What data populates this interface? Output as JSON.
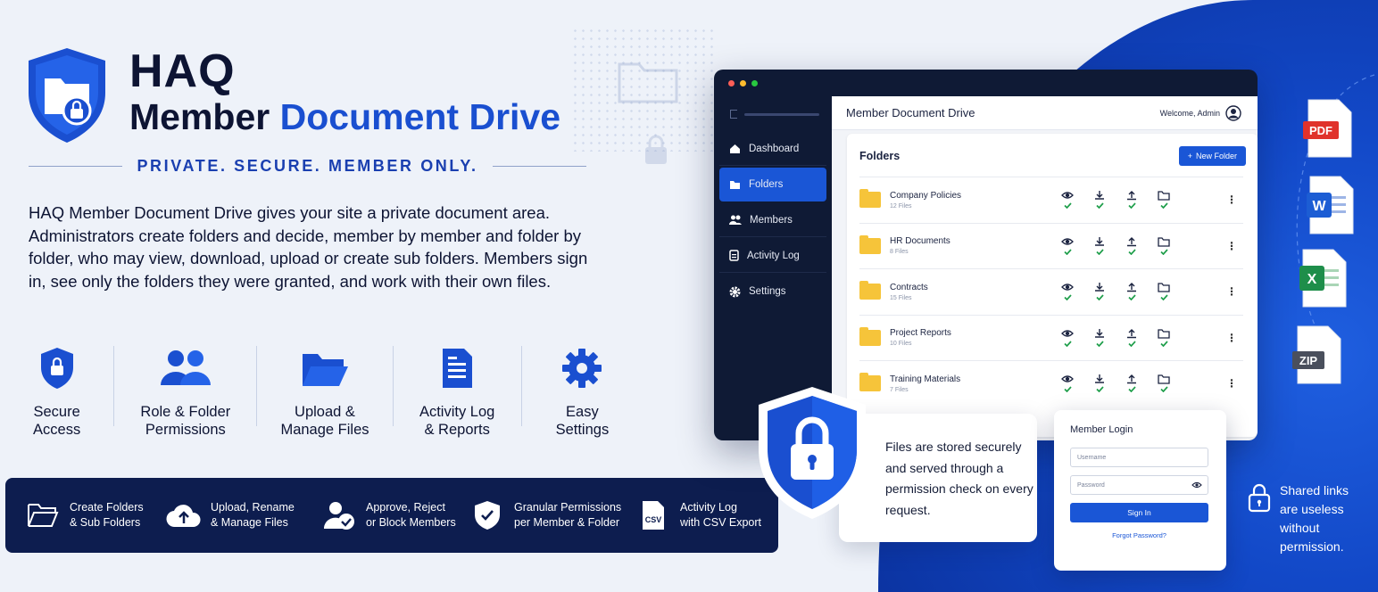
{
  "brand": {
    "name": "HAQ",
    "title_plain": "Member",
    "title_accent": "Document Drive",
    "tagline": "PRIVATE. SECURE. MEMBER ONLY."
  },
  "intro": "HAQ Member Document Drive gives your site a private document area. Administrators create folders and decide, member by member and folder by folder, who may view, download, upload or create sub folders. Members sign in, see only the folders they were granted, and work with their own files.",
  "features": [
    {
      "line1": "Secure",
      "line2": "Access"
    },
    {
      "line1": "Role & Folder",
      "line2": "Permissions"
    },
    {
      "line1": "Upload &",
      "line2": "Manage Files"
    },
    {
      "line1": "Activity Log",
      "line2": "& Reports"
    },
    {
      "line1": "Easy",
      "line2": "Settings"
    }
  ],
  "strip": [
    {
      "line1": "Create Folders",
      "line2": "& Sub Folders"
    },
    {
      "line1": "Upload, Rename",
      "line2": "& Manage Files"
    },
    {
      "line1": "Approve, Reject",
      "line2": "or Block Members"
    },
    {
      "line1": "Granular Permissions",
      "line2": "per Member & Folder"
    },
    {
      "line1": "Activity Log",
      "line2": "with CSV Export"
    }
  ],
  "app": {
    "title": "Member Document Drive",
    "welcome": "Welcome, Admin",
    "sidebar": [
      {
        "label": "Dashboard",
        "icon": "home-icon",
        "active": false
      },
      {
        "label": "Folders",
        "icon": "folder-icon",
        "active": true
      },
      {
        "label": "Members",
        "icon": "users-icon",
        "active": false
      },
      {
        "label": "Activity Log",
        "icon": "log-icon",
        "active": false
      },
      {
        "label": "Settings",
        "icon": "gear-icon",
        "active": false
      }
    ],
    "panel_title": "Folders",
    "new_folder": "New Folder",
    "folders": [
      {
        "name": "Company Policies",
        "count": "12 Files"
      },
      {
        "name": "HR Documents",
        "count": "8 Files"
      },
      {
        "name": "Contracts",
        "count": "15 Files"
      },
      {
        "name": "Project Reports",
        "count": "10 Files"
      },
      {
        "name": "Training Materials",
        "count": "7 Files"
      }
    ]
  },
  "callout": "Files are stored securely and served through a permission check on every request.",
  "login": {
    "title": "Member Login",
    "username_placeholder": "Username",
    "password_placeholder": "Password",
    "signin": "Sign In",
    "forgot": "Forgot Password?"
  },
  "file_types": [
    "PDF",
    "W",
    "X",
    "ZIP"
  ],
  "shared_note": "Shared links are useless without permission.",
  "colors": {
    "accent": "#1a56d6",
    "dark": "#0d1d4f",
    "check": "#1e9e4a"
  }
}
